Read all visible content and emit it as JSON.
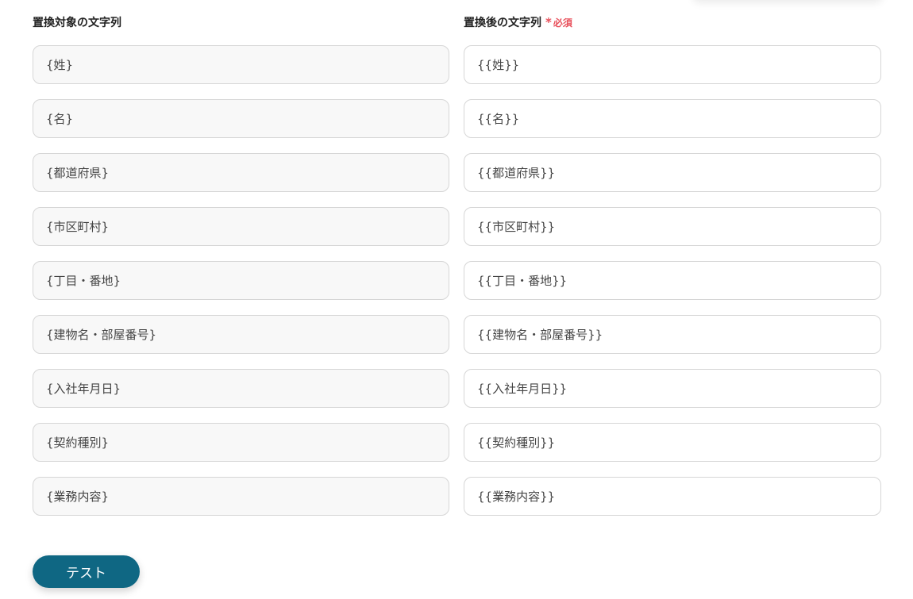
{
  "left_column": {
    "header": "置換対象の文字列",
    "fields": [
      {
        "value": "{姓}"
      },
      {
        "value": "{名}"
      },
      {
        "value": "{都道府県}"
      },
      {
        "value": "{市区町村}"
      },
      {
        "value": "{丁目・番地}"
      },
      {
        "value": "{建物名・部屋番号}"
      },
      {
        "value": "{入社年月日}"
      },
      {
        "value": "{契約種別}"
      },
      {
        "value": "{業務内容}"
      }
    ]
  },
  "right_column": {
    "header": "置換後の文字列",
    "required_label": "必須",
    "required_mark": "*",
    "fields": [
      {
        "value": "{{姓}}"
      },
      {
        "value": "{{名}}"
      },
      {
        "value": "{{都道府県}}"
      },
      {
        "value": "{{市区町村}}"
      },
      {
        "value": "{{丁目・番地}}"
      },
      {
        "value": "{{建物名・部屋番号}}"
      },
      {
        "value": "{{入社年月日}}"
      },
      {
        "value": "{{契約種別}}"
      },
      {
        "value": "{{業務内容}}"
      }
    ]
  },
  "actions": {
    "test_label": "テスト"
  },
  "colors": {
    "button": "#0f6783",
    "required": "#e8505b"
  }
}
